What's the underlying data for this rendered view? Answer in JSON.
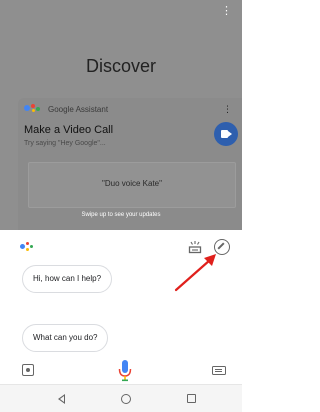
{
  "discover": {
    "title": "Discover",
    "swipe_hint": "Swipe up to see your updates",
    "card": {
      "source": "Google Assistant",
      "title": "Make a Video Call",
      "subtitle": "Try saying \"Hey Google\"...",
      "suggestion": "\"Duo voice Kate\"",
      "action_icon": "duo-video-icon"
    }
  },
  "assistant": {
    "greeting": "Hi, how can I help?",
    "suggestion_chip": "What can you do?",
    "icons": {
      "logo": "google-assistant-dots",
      "updates": "updates-icon",
      "explore": "compass-icon",
      "lens": "lens-icon",
      "mic": "mic-icon",
      "keyboard": "keyboard-icon"
    }
  },
  "colors": {
    "dim_overlay": "#8f8f8f",
    "duo_blue": "#2e5fae",
    "annotation_arrow": "#e0201c",
    "g_blue": "#4285f4",
    "g_red": "#ea4335",
    "g_yellow": "#fbbc05",
    "g_green": "#34a853"
  }
}
